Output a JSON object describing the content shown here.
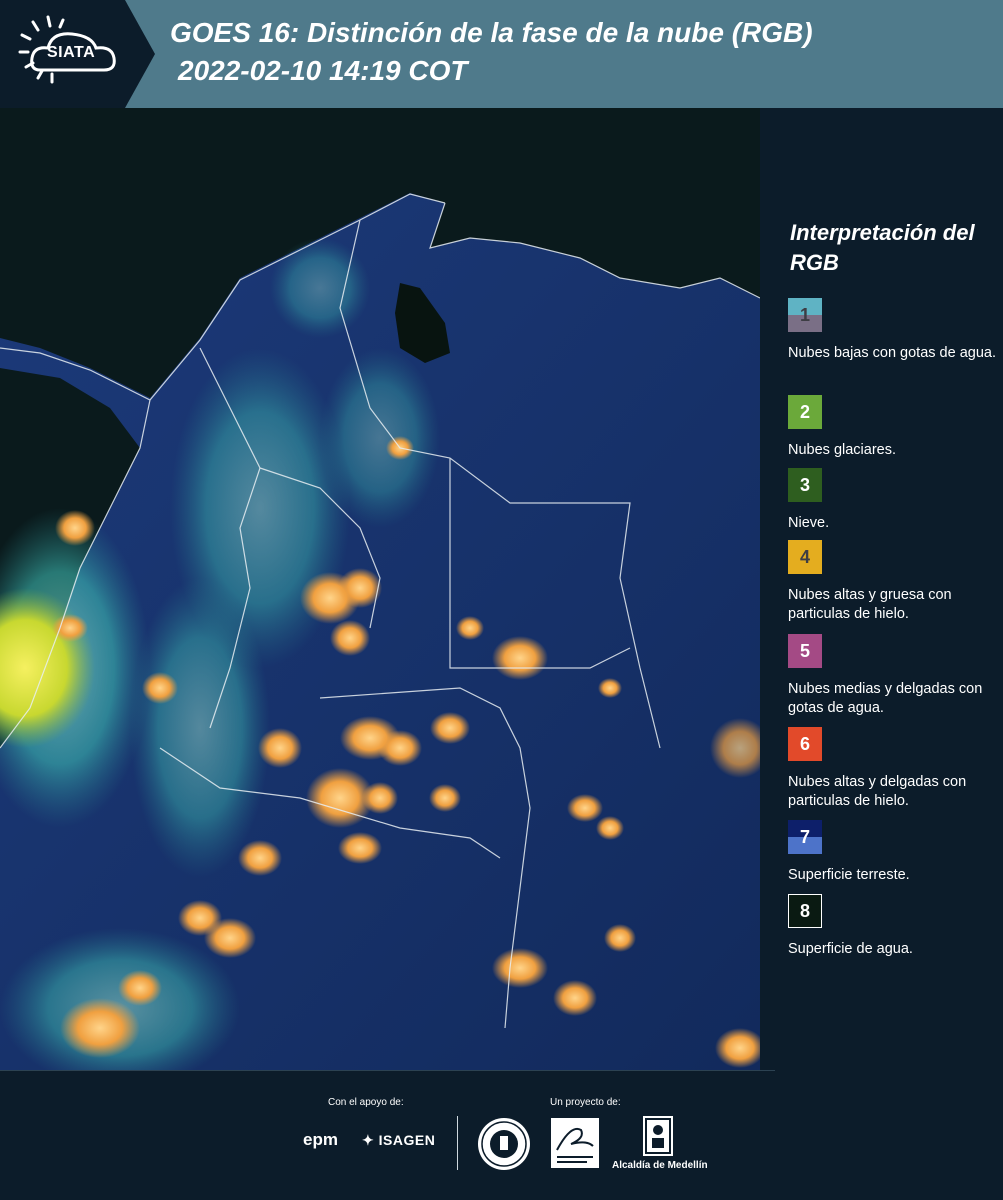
{
  "header": {
    "logo_text": "SIATA",
    "title_line1": "GOES 16: Distinción de la fase de la nube (RGB)",
    "title_line2": "2022-02-10 14:19 COT",
    "background_color": "#4f7a8b"
  },
  "map": {
    "description_icon": "satellite-rgb-image"
  },
  "legend": {
    "title": "Interpretación del RGB",
    "items": [
      {
        "number": "1",
        "label": "Nubes bajas con gotas de agua.",
        "color_top": "#5fb3c4",
        "color_bottom": "#7a6f86",
        "num_color": "#3d3d44"
      },
      {
        "number": "2",
        "label": "Nubes glaciares.",
        "color": "#6ba93a",
        "num_color": "#ffffff"
      },
      {
        "number": "3",
        "label": "Nieve.",
        "color": "#2e5e1f",
        "num_color": "#ffffff"
      },
      {
        "number": "4",
        "label": "Nubes altas y gruesa con particulas de hielo.",
        "color": "#e4ad1f",
        "num_color": "#3d3d44"
      },
      {
        "number": "5",
        "label": "Nubes medias y delgadas con gotas de agua.",
        "color": "#a44a85",
        "num_color": "#ffffff"
      },
      {
        "number": "6",
        "label": "Nubes altas y delgadas con particulas de hielo.",
        "color": "#e24a2a",
        "num_color": "#ffffff"
      },
      {
        "number": "7",
        "label": "Superficie terreste.",
        "color_top": "#0d1f6a",
        "color_bottom": "#4d73c9",
        "num_color": "#ffffff"
      },
      {
        "number": "8",
        "label": "Superficie de agua.",
        "color": "#0a1a12",
        "num_color": "#ffffff",
        "border": "#ffffff"
      }
    ]
  },
  "footer": {
    "support_label": "Con el apoyo de:",
    "project_label": "Un proyecto de:",
    "epm": "epm",
    "isagen": "ISAGEN",
    "alcaldia": "Alcaldía de Medellín"
  }
}
